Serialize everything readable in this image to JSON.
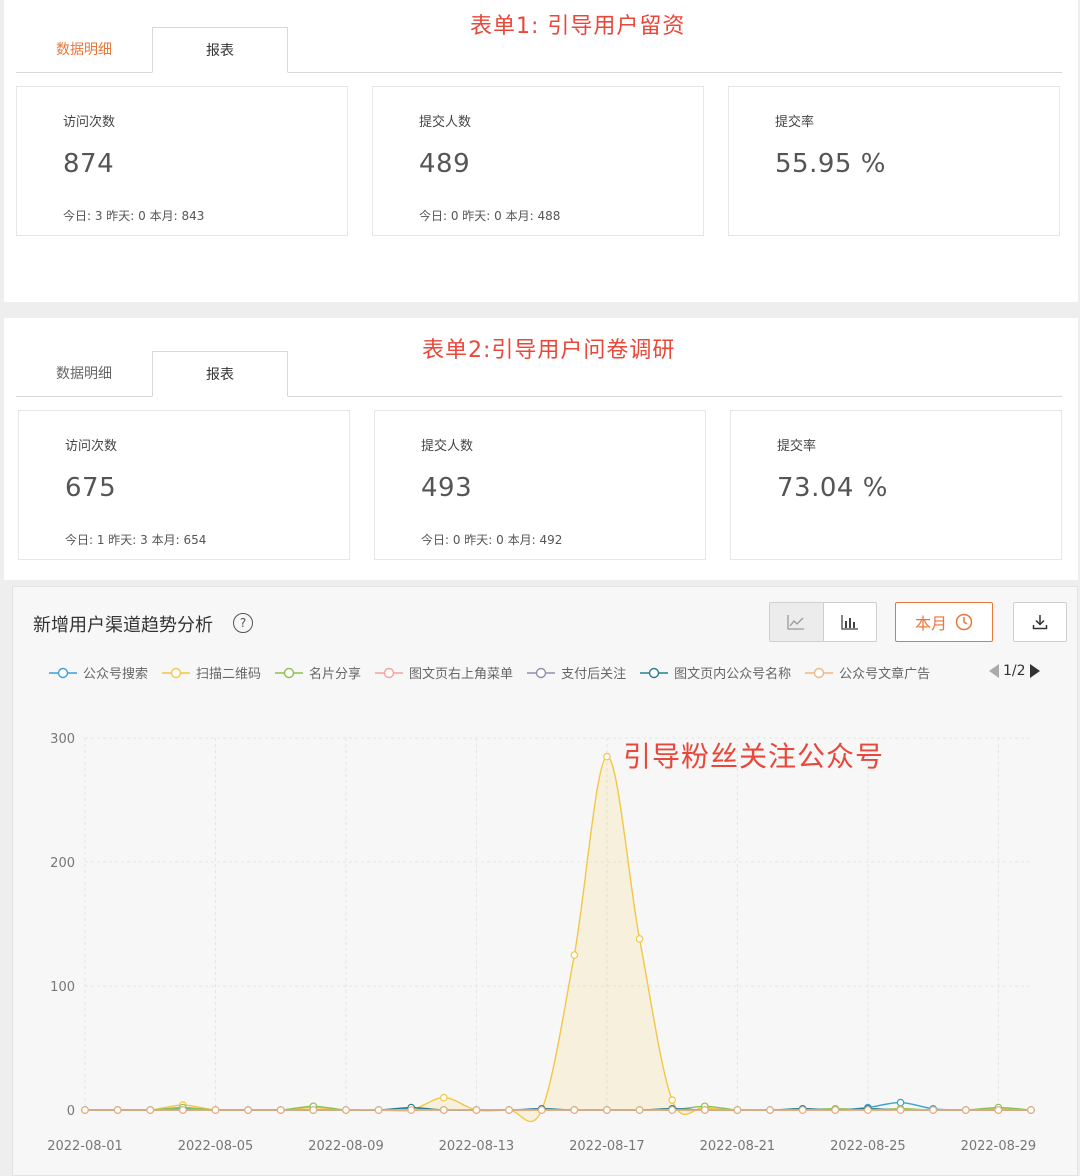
{
  "form1": {
    "title": "表单1: 引导用户留资",
    "tabs": [
      "数据明细",
      "报表"
    ],
    "cards": [
      {
        "label": "访问次数",
        "value": "874",
        "sub": "今日: 3 昨天: 0 本月: 843"
      },
      {
        "label": "提交人数",
        "value": "489",
        "sub": "今日: 0 昨天: 0 本月: 488"
      },
      {
        "label": "提交率",
        "value": "55.95 %",
        "sub": ""
      }
    ]
  },
  "form2": {
    "title": "表单2:引导用户问卷调研",
    "tabs": [
      "数据明细",
      "报表"
    ],
    "cards": [
      {
        "label": "访问次数",
        "value": "675",
        "sub": "今日: 1 昨天: 3 本月: 654"
      },
      {
        "label": "提交人数",
        "value": "493",
        "sub": "今日: 0 昨天: 0 本月: 492"
      },
      {
        "label": "提交率",
        "value": "73.04 %",
        "sub": ""
      }
    ]
  },
  "trend": {
    "title": "新增用户渠道趋势分析",
    "help_icon": "question-circle-icon",
    "line_icon": "line-chart-icon",
    "bar_icon": "bar-chart-icon",
    "month_label": "本月",
    "clock_icon": "clock-icon",
    "download_icon": "download-icon",
    "pager": "1/2",
    "annotation": "引导粉丝关注公众号",
    "colors": {
      "accent": "#e8773a",
      "red": "#e8473a"
    }
  },
  "chart_data": {
    "type": "line",
    "title": "",
    "xlabel": "",
    "ylabel": "",
    "ylim": [
      0,
      300
    ],
    "y_ticks": [
      "0",
      "100",
      "200",
      "300"
    ],
    "x": [
      "2022-08-01",
      "2022-08-02",
      "2022-08-03",
      "2022-08-04",
      "2022-08-05",
      "2022-08-06",
      "2022-08-07",
      "2022-08-08",
      "2022-08-09",
      "2022-08-10",
      "2022-08-11",
      "2022-08-12",
      "2022-08-13",
      "2022-08-14",
      "2022-08-15",
      "2022-08-16",
      "2022-08-17",
      "2022-08-18",
      "2022-08-19",
      "2022-08-20",
      "2022-08-21",
      "2022-08-22",
      "2022-08-23",
      "2022-08-24",
      "2022-08-25",
      "2022-08-26",
      "2022-08-27",
      "2022-08-28",
      "2022-08-29",
      "2022-08-30"
    ],
    "x_tick_labels": [
      "2022-08-01",
      "2022-08-05",
      "2022-08-09",
      "2022-08-13",
      "2022-08-17",
      "2022-08-21",
      "2022-08-25",
      "2022-08-29"
    ],
    "legend_position": "top",
    "grid": true,
    "series": [
      {
        "name": "公众号搜索",
        "color": "#3ba1d4",
        "area": false,
        "values": [
          0,
          0,
          0,
          1,
          0,
          0,
          0,
          0,
          0,
          0,
          1,
          0,
          0,
          0,
          0,
          0,
          0,
          0,
          0,
          0,
          0,
          0,
          0,
          0,
          2,
          6,
          1,
          0,
          0,
          0
        ]
      },
      {
        "name": "扫描二维码",
        "color": "#f2c744",
        "area": true,
        "values": [
          0,
          0,
          0,
          4,
          0,
          0,
          0,
          2,
          0,
          0,
          0,
          10,
          0,
          0,
          0,
          125,
          285,
          138,
          8,
          2,
          0,
          0,
          1,
          0,
          0,
          0,
          0,
          0,
          1,
          0
        ]
      },
      {
        "name": "名片分享",
        "color": "#8cc152",
        "area": false,
        "values": [
          0,
          0,
          0,
          2,
          0,
          0,
          0,
          3,
          0,
          0,
          0,
          0,
          0,
          0,
          0,
          0,
          0,
          0,
          0,
          3,
          0,
          0,
          0,
          1,
          0,
          1,
          0,
          0,
          2,
          0
        ]
      },
      {
        "name": "图文页右上角菜单",
        "color": "#f2a39a",
        "area": false,
        "values": [
          0,
          0,
          0,
          0,
          0,
          0,
          0,
          0,
          0,
          0,
          0,
          0,
          0,
          0,
          0,
          0,
          0,
          0,
          0,
          0,
          0,
          0,
          0,
          0,
          0,
          0,
          0,
          0,
          0,
          0
        ]
      },
      {
        "name": "支付后关注",
        "color": "#8d8fb0",
        "area": false,
        "values": [
          0,
          0,
          0,
          0,
          0,
          0,
          0,
          0,
          0,
          0,
          0,
          0,
          0,
          0,
          0,
          0,
          0,
          0,
          0,
          0,
          0,
          0,
          0,
          0,
          0,
          0,
          0,
          0,
          0,
          0
        ]
      },
      {
        "name": "图文页内公众号名称",
        "color": "#2a7f8f",
        "area": false,
        "values": [
          0,
          0,
          0,
          0,
          0,
          0,
          0,
          0,
          0,
          0,
          2,
          0,
          0,
          0,
          1,
          0,
          0,
          0,
          1,
          0,
          0,
          0,
          1,
          0,
          1,
          0,
          0,
          0,
          0,
          0
        ]
      },
      {
        "name": "公众号文章广告",
        "color": "#f0b583",
        "area": false,
        "values": [
          0,
          0,
          0,
          0,
          0,
          0,
          0,
          0,
          0,
          0,
          0,
          0,
          0,
          0,
          0,
          0,
          0,
          0,
          0,
          0,
          0,
          0,
          0,
          0,
          0,
          0,
          0,
          0,
          0,
          0
        ]
      }
    ]
  }
}
